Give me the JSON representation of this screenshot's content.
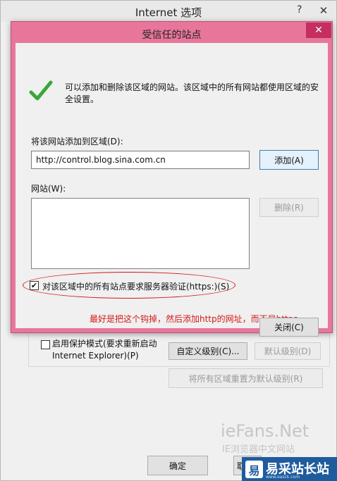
{
  "parent_window": {
    "title": "Internet 选项",
    "help_glyph": "?",
    "close_glyph": "✕",
    "protected_mode": {
      "checked": false,
      "label_line1": "启用保护模式(要求重新启动",
      "label_line2": "Internet Explorer)(P)"
    },
    "buttons": {
      "custom_level": "自定义级别(C)...",
      "default_level": "默认级别(D)",
      "reset_all": "将所有区域重置为默认级别(R)",
      "ok": "确定",
      "cancel_partial": "取"
    }
  },
  "dialog": {
    "title": "受信任的站点",
    "close_glyph": "✕",
    "info_text": "可以添加和删除该区域的网站。该区域中的所有网站都使用区域的安全设置。",
    "add_label": "将该网站添加到区域(D):",
    "url_value": "http://control.blog.sina.com.cn",
    "add_button": "添加(A)",
    "sites_label": "网站(W):",
    "sites": [],
    "remove_button": "删除(R)",
    "https_check": {
      "checked": true,
      "check_glyph": "✔",
      "label": "对该区域中的所有站点要求服务器验证(https:)(S)"
    },
    "close_button": "关闭(C)"
  },
  "annotation": {
    "text": "最好是把这个钩掉，然后添加http的网址，而不是https",
    "color": "#d51a1a"
  },
  "watermark": {
    "title": "ieFans.Net",
    "subtitle": "IE浏览器中文网站"
  },
  "brand_badge": {
    "logo_glyph": "易",
    "text": "易采站长站",
    "url": "www.easck.com"
  },
  "colors": {
    "dialog_frame": "#e8769b",
    "close_red": "#c42f60",
    "check_green": "#3aa63a",
    "brand_blue": "#1f5c9e"
  }
}
